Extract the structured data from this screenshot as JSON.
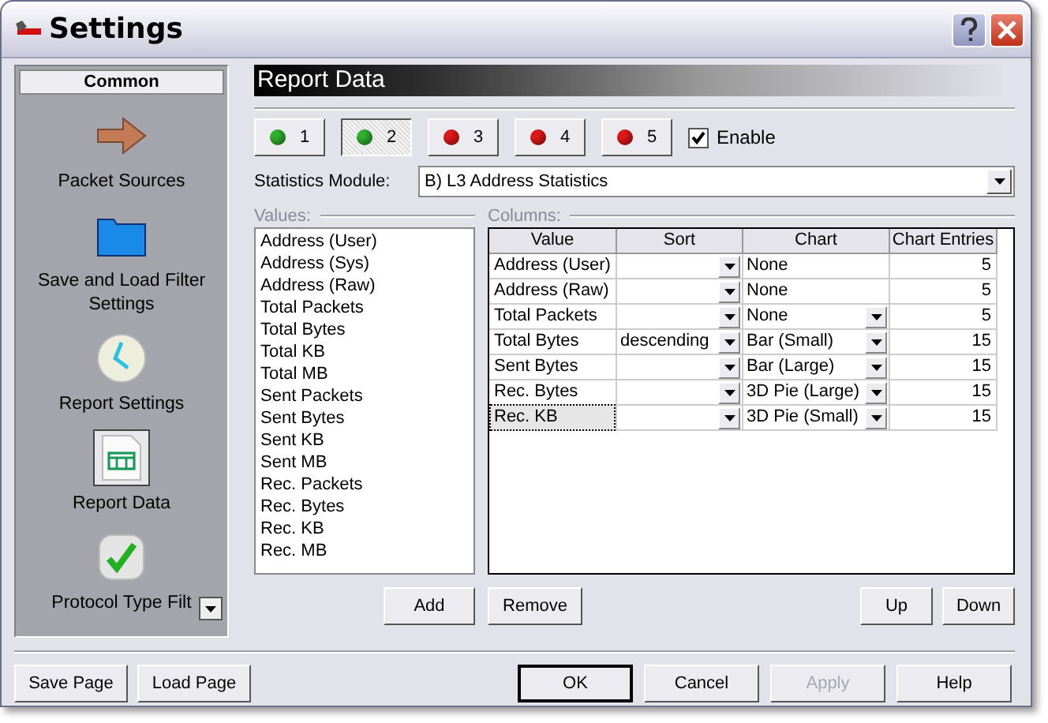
{
  "window": {
    "title": "Settings"
  },
  "sidebar": {
    "header": "Common",
    "items": [
      {
        "label": "Packet Sources",
        "kind": "arrow",
        "selected": false
      },
      {
        "label": "Save and Load Filter Settings",
        "kind": "folder",
        "selected": false
      },
      {
        "label": "Report Settings",
        "kind": "clock",
        "selected": false
      },
      {
        "label": "Report Data",
        "kind": "table",
        "selected": true
      },
      {
        "label": "Protocol Type Filt",
        "kind": "check",
        "selected": false
      }
    ]
  },
  "page": {
    "title": "Report Data",
    "slots": [
      {
        "label": "1",
        "color": "#2fb02f",
        "selected": false
      },
      {
        "label": "2",
        "color": "#2fb02f",
        "selected": true
      },
      {
        "label": "3",
        "color": "#e01818",
        "selected": false
      },
      {
        "label": "4",
        "color": "#e01818",
        "selected": false
      },
      {
        "label": "5",
        "color": "#e01818",
        "selected": false
      }
    ],
    "enable": {
      "label": "Enable",
      "checked": true
    },
    "module": {
      "label": "Statistics Module:",
      "value": "B)  L3 Address Statistics"
    },
    "values": {
      "label": "Values:",
      "items": [
        "Address (User)",
        "Address (Sys)",
        "Address (Raw)",
        "Total Packets",
        "Total Bytes",
        "Total KB",
        "Total MB",
        "Sent Packets",
        "Sent Bytes",
        "Sent KB",
        "Sent MB",
        "Rec. Packets",
        "Rec. Bytes",
        "Rec. KB",
        "Rec. MB"
      ]
    },
    "columns": {
      "label": "Columns:",
      "headers": [
        "Value",
        "Sort",
        "Chart",
        "Chart Entries"
      ],
      "rows": [
        {
          "value": "Address (User)",
          "sort": "",
          "chart": "None",
          "chart_dropdown": false,
          "entries": "5",
          "selected": false
        },
        {
          "value": "Address (Raw)",
          "sort": "",
          "chart": "None",
          "chart_dropdown": false,
          "entries": "5",
          "selected": false
        },
        {
          "value": "Total Packets",
          "sort": "",
          "chart": "None",
          "chart_dropdown": true,
          "entries": "5",
          "selected": false
        },
        {
          "value": "Total Bytes",
          "sort": "descending",
          "chart": "Bar (Small)",
          "chart_dropdown": true,
          "entries": "15",
          "selected": false
        },
        {
          "value": "Sent Bytes",
          "sort": "",
          "chart": "Bar (Large)",
          "chart_dropdown": true,
          "entries": "15",
          "selected": false
        },
        {
          "value": "Rec. Bytes",
          "sort": "",
          "chart": "3D Pie (Large)",
          "chart_dropdown": true,
          "entries": "15",
          "selected": false
        },
        {
          "value": "Rec. KB",
          "sort": "",
          "chart": "3D Pie (Small)",
          "chart_dropdown": true,
          "entries": "15",
          "selected": true
        }
      ]
    },
    "buttons": {
      "add": "Add",
      "remove": "Remove",
      "up": "Up",
      "down": "Down"
    }
  },
  "footer": {
    "left": [
      "Save Page",
      "Load Page"
    ],
    "right": [
      {
        "label": "OK",
        "disabled": false
      },
      {
        "label": "Cancel",
        "disabled": false
      },
      {
        "label": "Apply",
        "disabled": true
      },
      {
        "label": "Help",
        "disabled": false
      }
    ]
  }
}
